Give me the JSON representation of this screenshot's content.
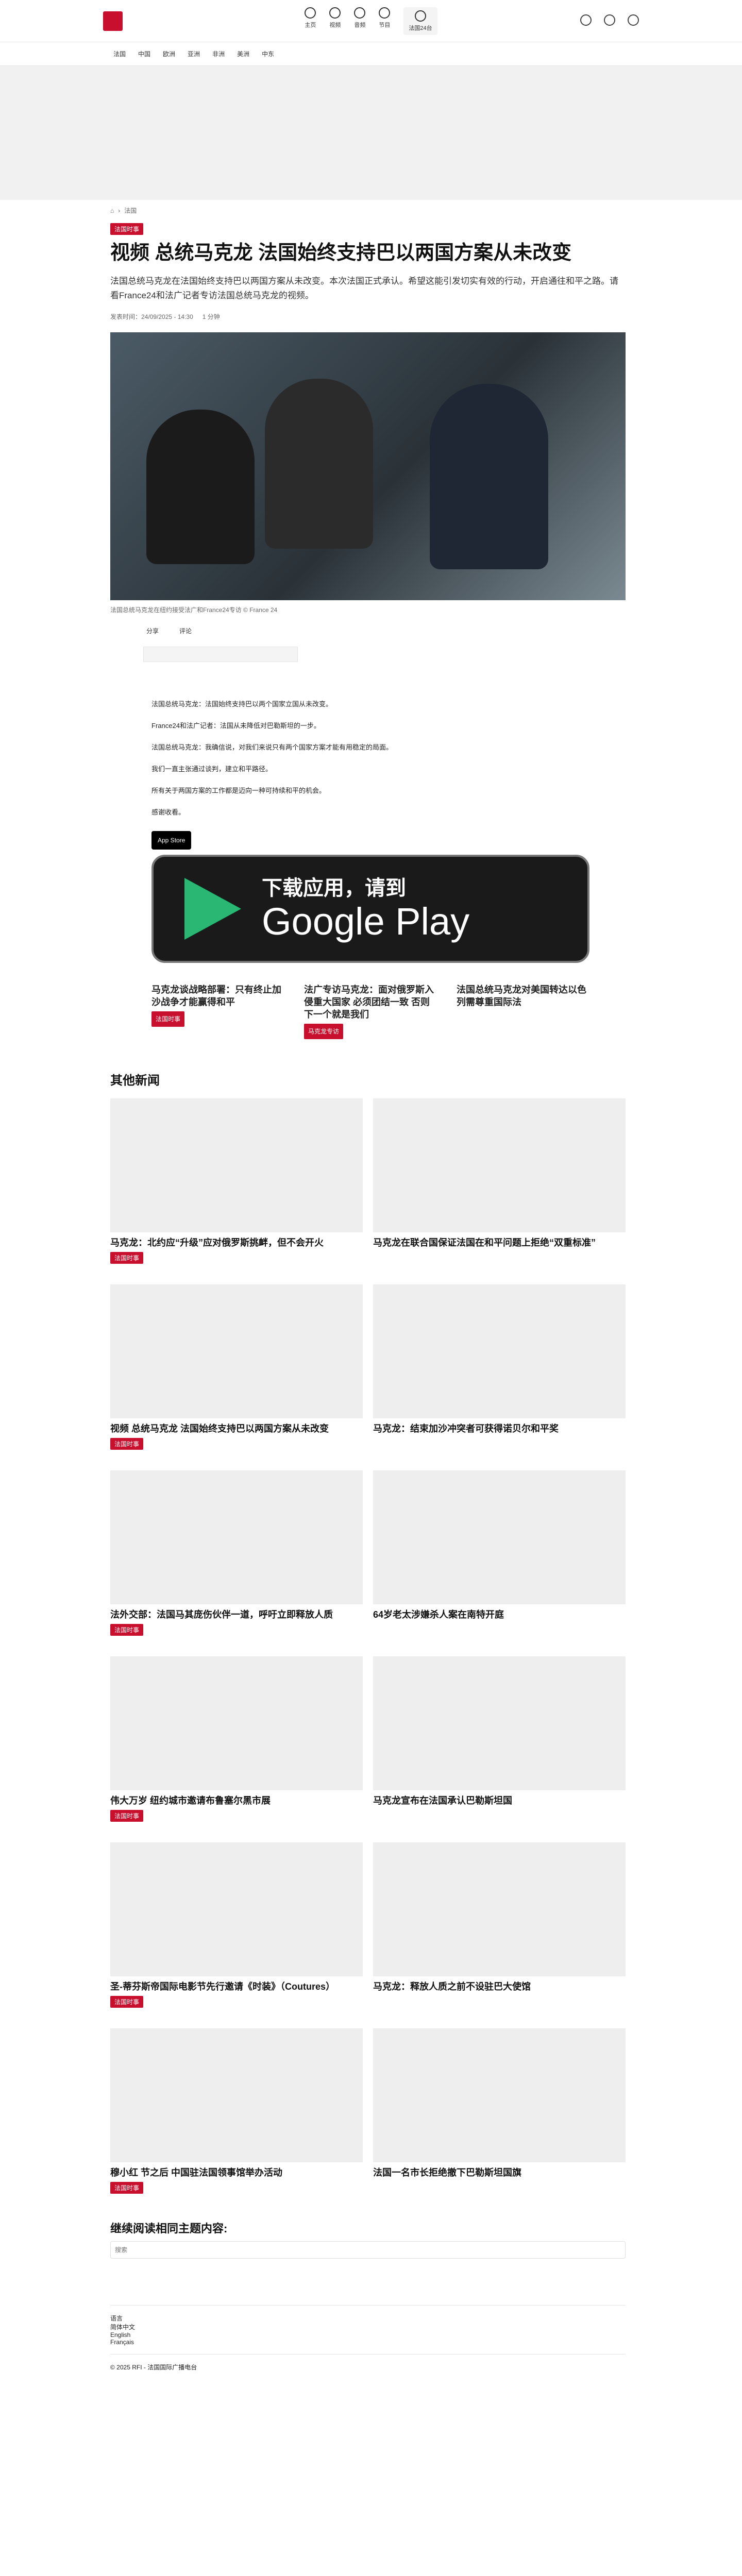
{
  "topnav": {
    "items": [
      {
        "label": "主页"
      },
      {
        "label": "视频"
      },
      {
        "label": "音频"
      },
      {
        "label": "节目"
      },
      {
        "label": "法国24台"
      }
    ]
  },
  "subnav": [
    "法国",
    "中国",
    "欧洲",
    "亚洲",
    "非洲",
    "美洲",
    "中东"
  ],
  "breadcrumb": {
    "home": "",
    "section": "法国"
  },
  "article": {
    "tag": "法国时事",
    "title": "视频 总统马克龙 法国始终支持巴以两国方案从未改变",
    "lead": "法国总统马克龙在法国始终支持巴以两国方案从未改变。本次法国正式承认。希望这能引发切实有效的行动，开启通往和平之路。请看France24和法广记者专访法国总统马克龙的视频。",
    "meta_date": "发表时间：24/09/2025 - 14:30",
    "meta_read": "1 分钟",
    "caption": "法国总统马克龙在纽约接受法广和France24专访 © France 24",
    "share": [
      "分享",
      "评论"
    ],
    "body": [
      "法国总统马克龙：法国始终支持巴以两个国家立国从未改变。",
      "France24和法广记者：法国从未降低对巴勒斯坦的一步。",
      "法国总统马克龙：我确信说，对我们来说只有两个国家方案才能有用稳定的局面。",
      "我们一直主张通过谈判，建立和平路径。",
      "所有关于两国方案的工作都是迈向一种可持续和平的机会。",
      "感谢收看。"
    ],
    "app_store_label": "App Store",
    "gp_line1": "下载应用，请到",
    "gp_line2": "Google Play"
  },
  "related": [
    {
      "title": "马克龙谈战略部署：只有终止加沙战争才能赢得和平",
      "tag": "法国时事"
    },
    {
      "title": "法广专访马克龙：面对俄罗斯入侵重大国家 必须团结一致 否则下一个就是我们",
      "tag": "马克龙专访"
    },
    {
      "title": "法国总统马克龙对美国转达以色列需尊重国际法",
      "tag": ""
    }
  ],
  "other_news_title": "其他新闻",
  "news": [
    {
      "title": "马克龙：北约应“升级”应对俄罗斯挑衅，但不会开火",
      "tag": "法国时事"
    },
    {
      "title": "马克龙在联合国保证法国在和平问题上拒绝“双重标准”",
      "tag": ""
    },
    {
      "title": "视频 总统马克龙 法国始终支持巴以两国方案从未改变",
      "tag": "法国时事"
    },
    {
      "title": "马克龙：结束加沙冲突者可获得诺贝尔和平奖",
      "tag": ""
    },
    {
      "title": "法外交部：法国马其庞伤伙伴一道，呼吁立即释放人质",
      "tag": "法国时事"
    },
    {
      "title": "64岁老太涉嫌杀人案在南特开庭",
      "tag": ""
    },
    {
      "title": "伟大万岁 纽约城市邀请布鲁塞尔黑市展",
      "tag": "法国时事"
    },
    {
      "title": "马克龙宣布在法国承认巴勒斯坦国",
      "tag": ""
    },
    {
      "title": "圣-蒂芬斯帝国际电影节先行邀请《时装》（Coutures）",
      "tag": "法国时事"
    },
    {
      "title": "马克龙：释放人质之前不设驻巴大使馆",
      "tag": ""
    },
    {
      "title": "穆小红 节之后 中国驻法国领事馆举办活动",
      "tag": "法国时事"
    },
    {
      "title": "法国一名市长拒绝撤下巴勒斯坦国旗",
      "tag": ""
    }
  ],
  "continue_title": "继续阅读相同主题内容:",
  "search_placeholder": "搜索",
  "footer": {
    "lines": [
      "语言",
      "简体中文",
      "English",
      "Français",
      "© 2025 RFI - 法国国际广播电台"
    ]
  },
  "colors": {
    "brand": "#c8102e"
  }
}
